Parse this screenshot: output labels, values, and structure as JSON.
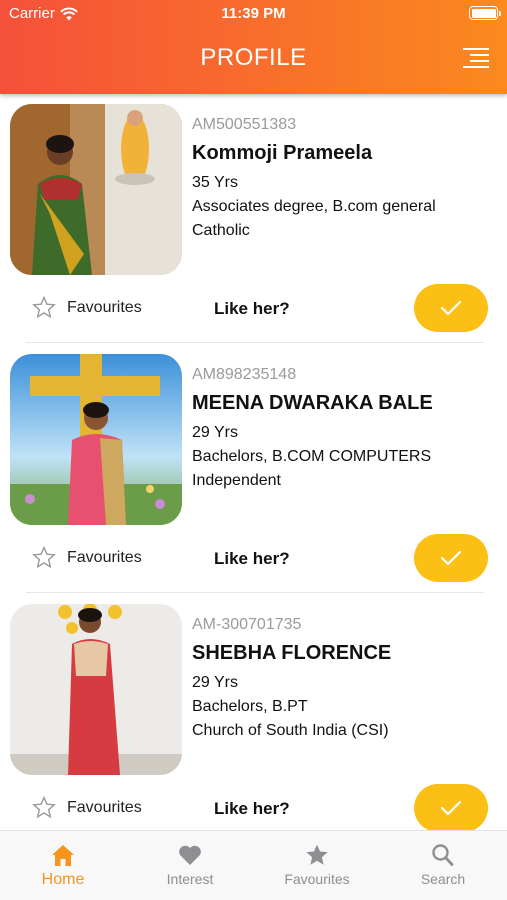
{
  "status_bar": {
    "carrier": "Carrier",
    "time": "11:39 PM"
  },
  "header": {
    "title": "PROFILE",
    "menu_icon": "menu-lines-icon"
  },
  "colors": {
    "header_start": "#f4513a",
    "header_end": "#fb8a1e",
    "like_button": "#fbbf15",
    "tab_active": "#f7941d",
    "tab_inactive": "#8e8e93"
  },
  "profiles": [
    {
      "id": "AM500551383",
      "name": "Kommoji Prameela",
      "age": "35 Yrs",
      "education": "Associates degree, B.com general",
      "religion": "Catholic",
      "fav_label": "Favourites",
      "like_label": "Like her?"
    },
    {
      "id": "AM898235148",
      "name": "MEENA DWARAKA BALE",
      "age": "29 Yrs",
      "education": "Bachelors, B.COM COMPUTERS",
      "religion": "Independent",
      "fav_label": "Favourites",
      "like_label": "Like her?"
    },
    {
      "id": "AM-300701735",
      "name": "SHEBHA FLORENCE",
      "age": "29 Yrs",
      "education": "Bachelors, B.PT",
      "religion": "Church of South India (CSI)",
      "fav_label": "Favourites",
      "like_label": "Like her?"
    }
  ],
  "tabs": [
    {
      "label": "Home",
      "icon": "home-icon",
      "active": true
    },
    {
      "label": "Interest",
      "icon": "heart-icon",
      "active": false
    },
    {
      "label": "Favourites",
      "icon": "star-icon",
      "active": false
    },
    {
      "label": "Search",
      "icon": "search-icon",
      "active": false
    }
  ]
}
